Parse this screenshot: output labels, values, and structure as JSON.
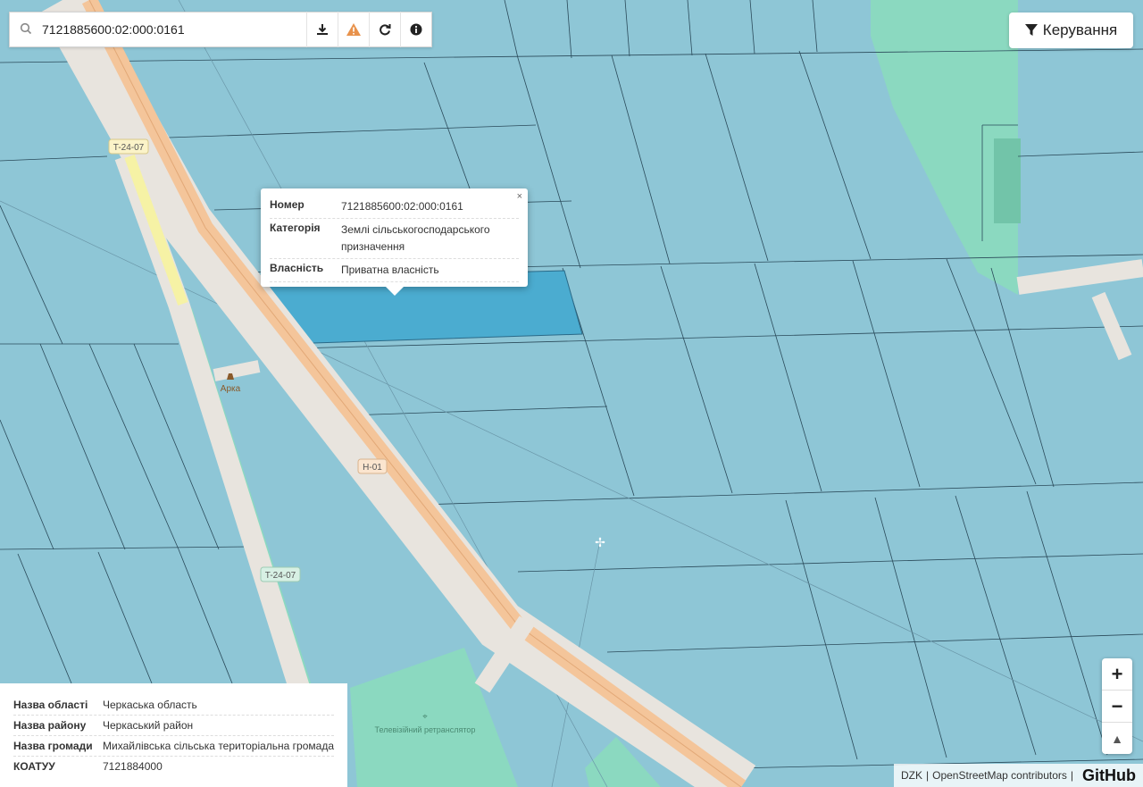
{
  "search": {
    "value": "7121885600:02:000:0161"
  },
  "toolbar": {
    "icons": [
      "download-icon",
      "warning-icon",
      "refresh-icon",
      "info-icon"
    ]
  },
  "control": {
    "label": "Керування"
  },
  "popup": {
    "rows": [
      {
        "key": "Номер",
        "value": "7121885600:02:000:0161"
      },
      {
        "key": "Категорія",
        "value": "Землі сільськогосподарського призначення"
      },
      {
        "key": "Власність",
        "value": "Приватна власність"
      }
    ],
    "close": "×"
  },
  "map_labels": {
    "road_t2407_a": "T-24-07",
    "road_h01": "H-01",
    "road_t2407_b": "T-24-07",
    "arka": "Арка",
    "tv_tower": "Телевізійний ретранслятор"
  },
  "info": {
    "rows": [
      {
        "key": "Назва області",
        "value": "Черкаська область"
      },
      {
        "key": "Назва району",
        "value": "Черкаський район"
      },
      {
        "key": "Назва громади",
        "value": "Михайлівська сільська територіальна громада"
      },
      {
        "key": "КОАТУУ",
        "value": "7121884000"
      }
    ]
  },
  "zoom": {
    "in": "+",
    "out": "−",
    "north": "▲"
  },
  "attribution": {
    "dzk": "DZK",
    "sep": "|",
    "osm": "OpenStreetMap contributors",
    "sep2": "|",
    "github": "GitHub"
  },
  "colors": {
    "parcel": "#8ec6d6",
    "parcel_border": "#2a4a5a",
    "selected": "#4bacd0",
    "road_major": "#f4c59a",
    "road_edge": "#e8e4de",
    "green": "#8bd9c0"
  }
}
